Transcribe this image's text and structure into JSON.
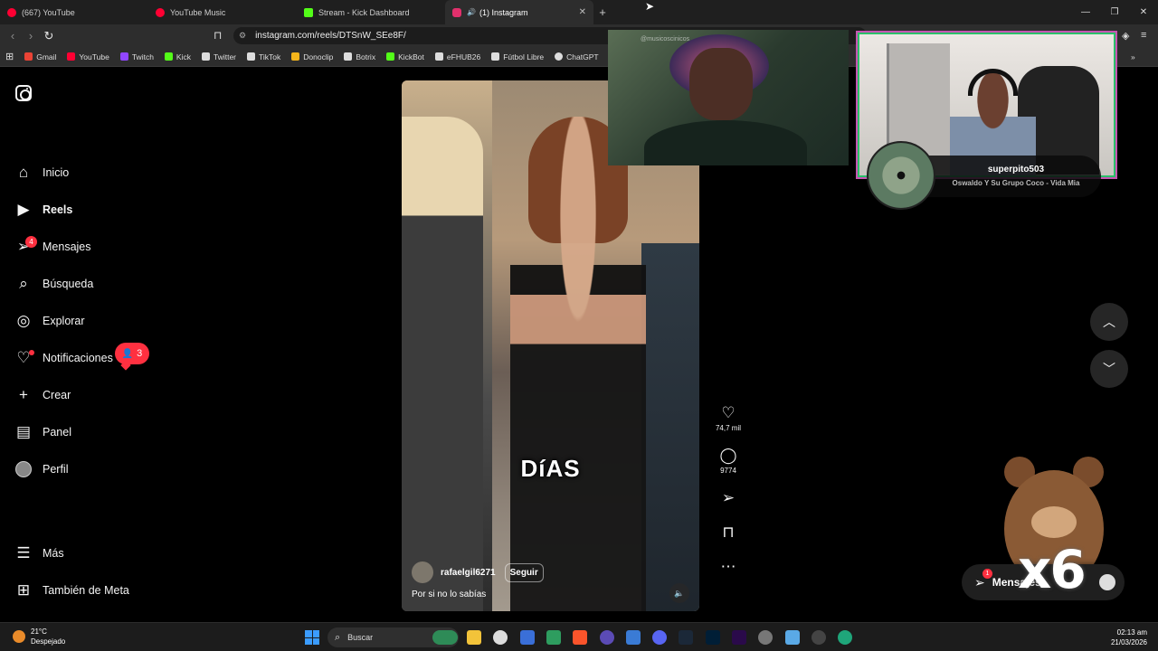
{
  "browser": {
    "tabs": [
      {
        "label": "(667) YouTube",
        "color": "#ff0033"
      },
      {
        "label": "YouTube Music",
        "color": "#ff0033"
      },
      {
        "label": "Stream - Kick Dashboard",
        "color": "#53fc18"
      },
      {
        "label": "(1) Instagram",
        "color": "#e1306c"
      }
    ],
    "url": "instagram.com/reels/DTSnW_SEe8F/",
    "bookmarks": [
      {
        "label": "Gmail",
        "color": "#ea4335"
      },
      {
        "label": "YouTube",
        "color": "#ff0033"
      },
      {
        "label": "Twitch",
        "color": "#9146ff"
      },
      {
        "label": "Kick",
        "color": "#53fc18"
      },
      {
        "label": "Twitter",
        "color": "#ffffff"
      },
      {
        "label": "TikTok",
        "color": "#ffffff"
      },
      {
        "label": "Donoclip",
        "color": "#f5b51b"
      },
      {
        "label": "Botrix",
        "color": "#ffffff"
      },
      {
        "label": "KickBot",
        "color": "#53fc18"
      },
      {
        "label": "eFHUB26",
        "color": "#ffffff"
      },
      {
        "label": "Fútbol Libre",
        "color": "#ffffff"
      },
      {
        "label": "ChatGPT",
        "color": "#ffffff"
      }
    ]
  },
  "sidebar": {
    "items": [
      {
        "label": "Inicio",
        "icon": "home-icon"
      },
      {
        "label": "Reels",
        "icon": "reels-icon"
      },
      {
        "label": "Mensajes",
        "icon": "messages-icon",
        "badge": "4"
      },
      {
        "label": "Búsqueda",
        "icon": "search-icon"
      },
      {
        "label": "Explorar",
        "icon": "explore-icon"
      },
      {
        "label": "Notificaciones",
        "icon": "heart-icon"
      },
      {
        "label": "Crear",
        "icon": "plus-icon"
      },
      {
        "label": "Panel",
        "icon": "dashboard-icon"
      },
      {
        "label": "Perfil",
        "icon": "avatar"
      },
      {
        "label": "Más",
        "icon": "menu-icon"
      },
      {
        "label": "También de Meta",
        "icon": "meta-icon"
      }
    ],
    "notifications_pill": "3"
  },
  "reel": {
    "overlay_text": "DíAS",
    "username": "rafaelgil6271",
    "follow_label": "Seguir",
    "caption": "Por si no lo sabías",
    "likes": "74,7 mil",
    "comments": "9774"
  },
  "stream_overlay": {
    "watermark": "@musicoscinicos",
    "streamer": "superpito503",
    "song": "Oswaldo Y Su Grupo Coco - Vida Mia",
    "multiplier": "x6",
    "messages_label": "Mensajes",
    "messages_badge": "1"
  },
  "taskbar": {
    "temperature": "21°C",
    "weather": "Despejado",
    "search_placeholder": "Buscar",
    "time": "02:13 am",
    "date": "21/03/2026"
  }
}
